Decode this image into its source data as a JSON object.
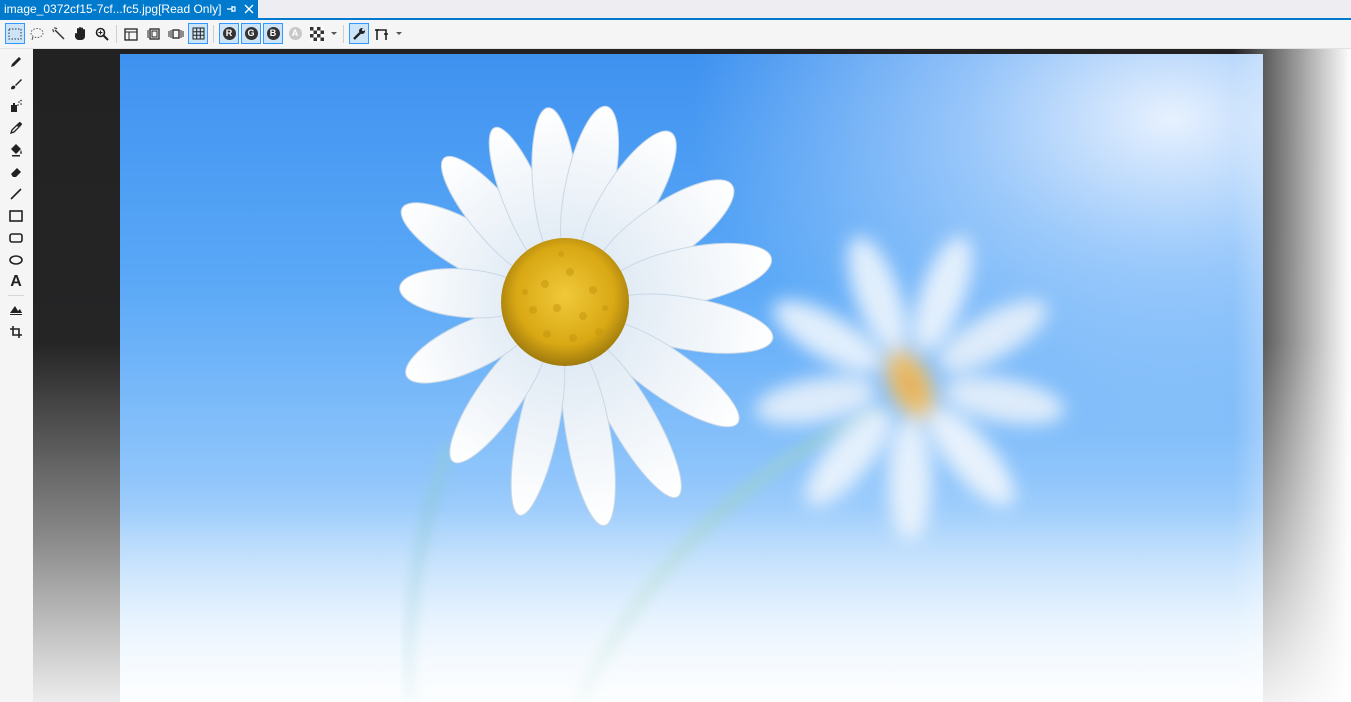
{
  "document_tab": {
    "title": "image_0372cf15-7cf...fc5.jpg[Read Only]",
    "pin_icon": "pin-icon",
    "close_icon": "close-icon"
  },
  "toolbar": {
    "selection_tools": [
      "rectangle-selection-icon",
      "lasso-selection-icon",
      "magic-wand-icon",
      "pan-hand-icon",
      "zoom-icon"
    ],
    "view_tools": [
      "frame-properties-icon",
      "next-frame-icon",
      "play-frames-icon",
      "grid-icon"
    ],
    "channels": {
      "red": "R",
      "green": "G",
      "blue": "B",
      "alpha": "A"
    },
    "background_icon": "checkerboard-icon",
    "properties_icon": "wrench-icon",
    "advanced_icon": "advanced-tools-icon"
  },
  "palette": {
    "tools": [
      "pencil-icon",
      "brush-icon",
      "airbrush-icon",
      "eyedropper-icon",
      "fill-bucket-icon",
      "eraser-icon",
      "line-icon",
      "rectangle-icon",
      "rounded-rectangle-icon",
      "ellipse-icon",
      "text-icon",
      "filter-icon",
      "crop-icon"
    ],
    "text_glyph": "A"
  },
  "colors": {
    "accent": "#007acc",
    "canvas_dark": "#252526",
    "sky_blue": "#4a9cf3"
  },
  "image": {
    "subject": "daisy-photo"
  }
}
